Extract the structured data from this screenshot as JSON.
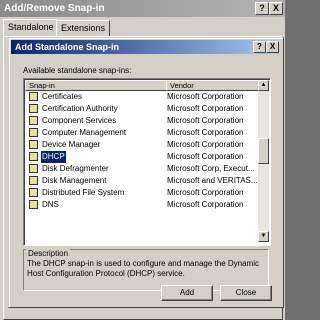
{
  "outer_window": {
    "title": "Add/Remove Snap-in",
    "help_btn": "?",
    "close_btn": "X",
    "tabs": [
      "Standalone",
      "Extensions"
    ]
  },
  "dialog": {
    "title": "Add Standalone Snap-in",
    "help_btn": "?",
    "close_btn": "X",
    "list_label": "Available standalone snap-ins:",
    "columns": [
      "Snap-in",
      "Vendor"
    ],
    "rows": [
      {
        "name": "Certificates",
        "vendor": "Microsoft Corporation"
      },
      {
        "name": "Certification Authority",
        "vendor": "Microsoft Corporation"
      },
      {
        "name": "Component Services",
        "vendor": "Microsoft Corporation"
      },
      {
        "name": "Computer Management",
        "vendor": "Microsoft Corporation"
      },
      {
        "name": "Device Manager",
        "vendor": "Microsoft Corporation"
      },
      {
        "name": "DHCP",
        "vendor": "Microsoft Corporation",
        "selected": true
      },
      {
        "name": "Disk Defragmenter",
        "vendor": "Microsoft Corp, Execut..."
      },
      {
        "name": "Disk Management",
        "vendor": "Microsoft and VERITAS..."
      },
      {
        "name": "Distributed File System",
        "vendor": "Microsoft Corporation"
      },
      {
        "name": "DNS",
        "vendor": "Microsoft Corporation"
      }
    ],
    "description_title": "Description",
    "description": "The DHCP snap-in is used to configure and manage the Dynamic Host Configuration Protocol (DHCP) service.",
    "buttons": {
      "add": "Add",
      "close": "Close"
    }
  },
  "colors": {
    "title_active": "#0a246a",
    "title_inactive": "#8a8a8a",
    "selection": "#0a246a",
    "face": "#d4d0c8"
  }
}
